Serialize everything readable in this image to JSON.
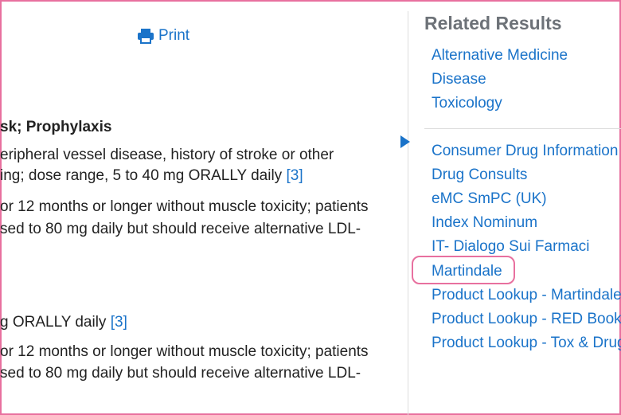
{
  "print": {
    "label": "Print",
    "icon": "printer-icon"
  },
  "main": {
    "heading_fragment": "sk; Prophylaxis",
    "para1": {
      "line1": "eripheral vessel disease, history of stroke or other",
      "line2": "ing; dose range, 5 to 40 mg ORALLY daily",
      "ref": "[3]"
    },
    "para2": {
      "line1": "or 12 months or longer without muscle toxicity; patients",
      "line2": "sed to 80 mg daily but should receive alternative LDL-"
    },
    "para3": {
      "line1": "g ORALLY daily",
      "ref": "[3]"
    },
    "para4": {
      "line1": "or 12 months or longer without muscle toxicity; patients",
      "line2": "sed to 80 mg daily but should receive alternative LDL-"
    }
  },
  "sidebar": {
    "title": "Related Results",
    "group1": [
      "Alternative Medicine",
      "Disease",
      "Toxicology"
    ],
    "group2": [
      "Consumer Drug Information",
      "Drug Consults",
      "eMC SmPC (UK)",
      "Index Nominum",
      "IT- Dialogo Sui Farmaci",
      "Martindale",
      "Product Lookup - Martindale",
      "Product Lookup - RED Book",
      "Product Lookup - Tox & Drug"
    ]
  },
  "colors": {
    "link": "#1a73c9",
    "title": "#6d7278",
    "highlight": "#e8709f"
  }
}
